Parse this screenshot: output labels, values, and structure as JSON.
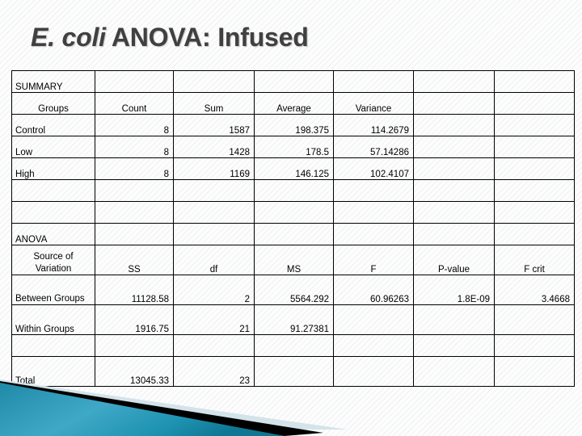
{
  "slide": {
    "title_italic": "E. coli",
    "title_rest": "ANOVA: Infused"
  },
  "table": {
    "summary": {
      "section_label": "SUMMARY",
      "headers": [
        "Groups",
        "Count",
        "Sum",
        "Average",
        "Variance",
        "",
        ""
      ],
      "rows": [
        {
          "group": "Control",
          "count": "8",
          "sum": "1587",
          "average": "198.375",
          "variance": "114.2679",
          "extra1": "",
          "extra2": ""
        },
        {
          "group": "Low",
          "count": "8",
          "sum": "1428",
          "average": "178.5",
          "variance": "57.14286",
          "extra1": "",
          "extra2": ""
        },
        {
          "group": "High",
          "count": "8",
          "sum": "1169",
          "average": "146.125",
          "variance": "102.4107",
          "extra1": "",
          "extra2": ""
        }
      ]
    },
    "anova": {
      "section_label": "ANOVA",
      "headers": [
        "Source of Variation",
        "SS",
        "df",
        "MS",
        "F",
        "P-value",
        "F crit"
      ],
      "rows": [
        {
          "source": "Between Groups",
          "ss": "11128.58",
          "df": "2",
          "ms": "5564.292",
          "f": "60.96263",
          "p_value": "1.8E-09",
          "f_crit": "3.4668"
        },
        {
          "source": "Within Groups",
          "ss": "1916.75",
          "df": "21",
          "ms": "91.27381",
          "f": "",
          "p_value": "",
          "f_crit": ""
        },
        {
          "source": "Total",
          "ss": "13045.33",
          "df": "23",
          "ms": "",
          "f": "",
          "p_value": "",
          "f_crit": ""
        }
      ]
    }
  },
  "banner": {
    "teal_light": "#49b3cf",
    "teal_dark": "#1f8aa8",
    "black": "#000000",
    "pale_blue": "#d3e3e9"
  }
}
